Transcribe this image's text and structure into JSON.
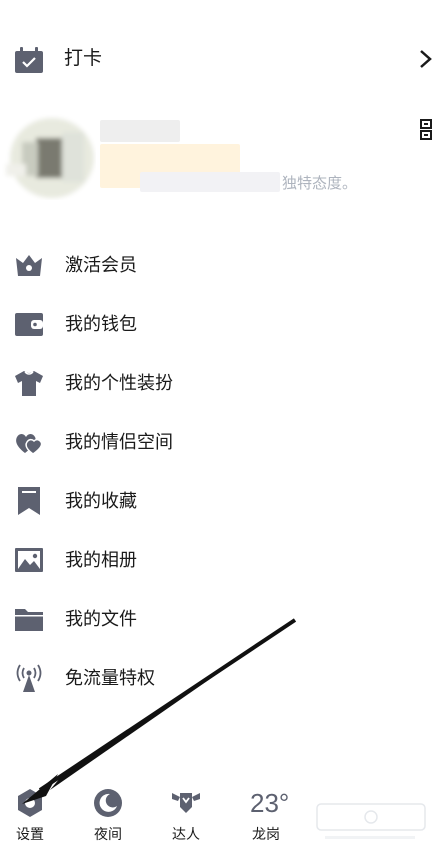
{
  "checkin": {
    "label": "打卡"
  },
  "profile": {
    "signature_tail": "独特态度。"
  },
  "menu": [
    {
      "label": "激活会员",
      "icon": "crown-icon"
    },
    {
      "label": "我的钱包",
      "icon": "wallet-icon"
    },
    {
      "label": "我的个性装扮",
      "icon": "shirt-icon"
    },
    {
      "label": "我的情侣空间",
      "icon": "hearts-icon"
    },
    {
      "label": "我的收藏",
      "icon": "bookmark-icon"
    },
    {
      "label": "我的相册",
      "icon": "photo-icon"
    },
    {
      "label": "我的文件",
      "icon": "folder-icon"
    },
    {
      "label": "免流量特权",
      "icon": "signal-tower-icon"
    }
  ],
  "bottom": {
    "settings": "设置",
    "night": "夜间",
    "expert": "达人",
    "weather_temp": "23°",
    "weather_city": "龙岗"
  },
  "colors": {
    "icon": "#5d6170",
    "text": "#1a1a1a"
  }
}
